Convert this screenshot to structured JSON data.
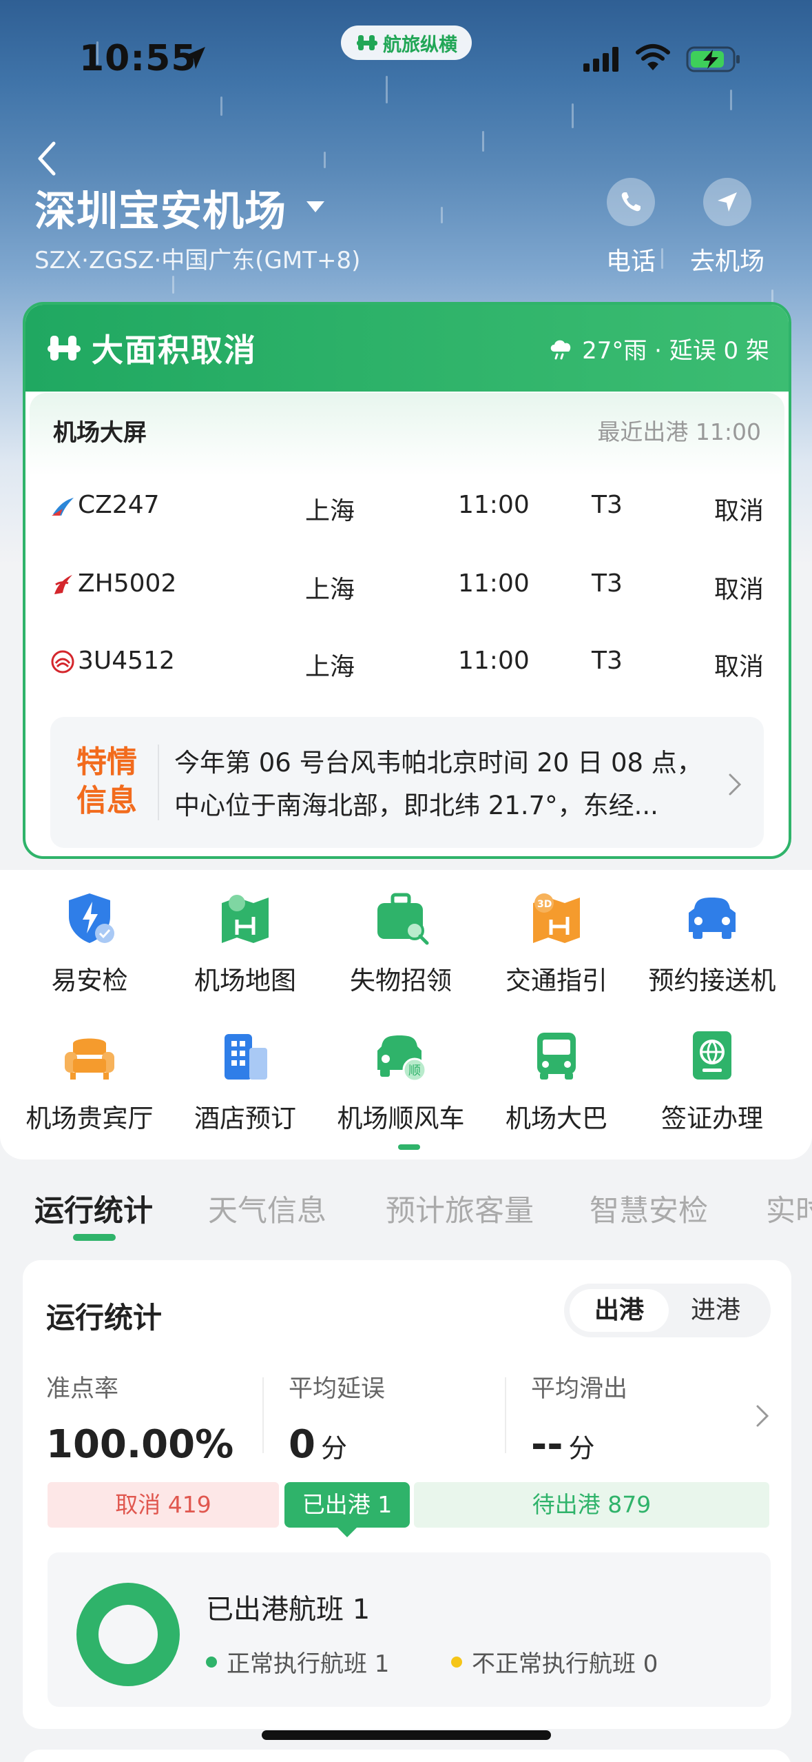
{
  "status_bar": {
    "time": "10:55",
    "brand": "航旅纵横"
  },
  "header": {
    "airport_name": "深圳宝安机场",
    "airport_sub": "SZX·ZGSZ·中国广东(GMT+8)",
    "actions": [
      {
        "label": "电话",
        "icon": "phone-icon"
      },
      {
        "label": "去机场",
        "icon": "navigate-icon"
      }
    ]
  },
  "alert": {
    "title": "大面积取消",
    "weather": "27°雨 · 延误 0 架",
    "screen_label": "机场大屏",
    "recent_departure": "最近出港 11:00",
    "flights": [
      {
        "flight_no": "CZ247",
        "dest": "上海",
        "time": "11:00",
        "terminal": "T3",
        "status": "取消",
        "airline_icon": "china-southern-logo"
      },
      {
        "flight_no": "ZH5002",
        "dest": "上海",
        "time": "11:00",
        "terminal": "T3",
        "status": "取消",
        "airline_icon": "shenzhen-airlines-logo"
      },
      {
        "flight_no": "3U4512",
        "dest": "上海",
        "time": "11:00",
        "terminal": "T3",
        "status": "取消",
        "airline_icon": "sichuan-airlines-logo"
      }
    ],
    "notice_tag_1": "特情",
    "notice_tag_2": "信息",
    "notice_line_1": "今年第 06 号台风韦帕北京时间 20 日 08 点，",
    "notice_line_2": "中心位于南海北部，即北纬 21.7°，东经..."
  },
  "services": [
    {
      "label": "易安检",
      "icon": "security-check-icon"
    },
    {
      "label": "机场地图",
      "icon": "airport-map-icon"
    },
    {
      "label": "失物招领",
      "icon": "lost-found-icon"
    },
    {
      "label": "交通指引",
      "icon": "traffic-guide-icon"
    },
    {
      "label": "预约接送机",
      "icon": "car-booking-icon"
    },
    {
      "label": "机场贵宾厅",
      "icon": "vip-lounge-icon"
    },
    {
      "label": "酒店预订",
      "icon": "hotel-icon"
    },
    {
      "label": "机场顺风车",
      "icon": "ride-share-icon"
    },
    {
      "label": "机场大巴",
      "icon": "bus-icon"
    },
    {
      "label": "签证办理",
      "icon": "visa-icon"
    }
  ],
  "tabs": [
    "运行统计",
    "天气信息",
    "预计旅客量",
    "智慧安检",
    "实时"
  ],
  "stats": {
    "title": "运行统计",
    "segment": {
      "active": "出港",
      "inactive": "进港"
    },
    "metrics": [
      {
        "label": "准点率",
        "value": "100.00%",
        "unit": ""
      },
      {
        "label": "平均延误",
        "value": "0",
        "unit": "分"
      },
      {
        "label": "平均滑出",
        "value": "--",
        "unit": "分"
      }
    ],
    "bars": {
      "cancel": "取消 419",
      "departed": "已出港 1",
      "waiting": "待出港 879"
    },
    "panel_title": "已出港航班 1",
    "legend_normal": "正常执行航班 1",
    "legend_abnormal": "不正常执行航班 0",
    "colors": {
      "accent": "#2fb36a",
      "cancel": "#e0574f",
      "abnormal": "#f5c518"
    }
  }
}
